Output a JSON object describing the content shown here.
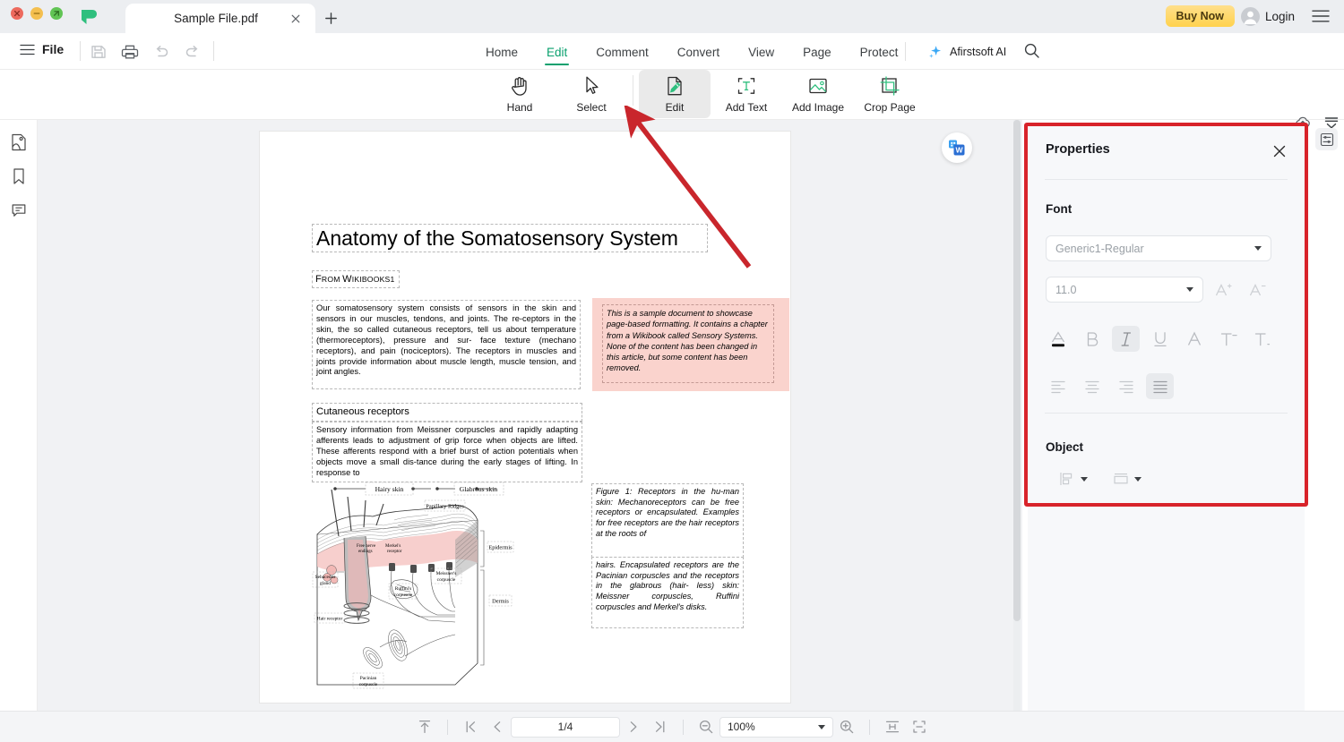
{
  "window": {
    "app_logo": "afirstsoft-logo-icon",
    "traffic_lights": [
      "close",
      "minimize",
      "maximize"
    ],
    "tab": {
      "title": "Sample File.pdf",
      "close_label": "×"
    },
    "new_tab_label": "+",
    "buy_now_label": "Buy Now",
    "login_label": "Login",
    "menu_icon": "hamburger-icon"
  },
  "menubar": {
    "file_label": "File",
    "quick_actions": [
      "save-icon",
      "print-icon",
      "undo-icon",
      "redo-icon"
    ],
    "tabs": [
      {
        "label": "Home",
        "active": false
      },
      {
        "label": "Edit",
        "active": true
      },
      {
        "label": "Comment",
        "active": false
      },
      {
        "label": "Convert",
        "active": false
      },
      {
        "label": "View",
        "active": false
      },
      {
        "label": "Page",
        "active": false
      },
      {
        "label": "Protect",
        "active": false
      }
    ],
    "ai_label": "Afirstsoft AI",
    "search_icon": "search-icon",
    "upload_icon": "cloud-upload-icon",
    "collapse_icon": "collapse-ribbon-icon"
  },
  "ribbon": {
    "tools": [
      {
        "label": "Hand",
        "icon": "hand-icon",
        "active": false
      },
      {
        "label": "Select",
        "icon": "cursor-arrow-icon",
        "active": false
      },
      {
        "label": "Edit",
        "icon": "edit-pencil-document-icon",
        "active": true
      },
      {
        "label": "Add Text",
        "icon": "add-text-icon",
        "active": false
      },
      {
        "label": "Add Image",
        "icon": "add-image-icon",
        "active": false
      },
      {
        "label": "Crop Page",
        "icon": "crop-page-icon",
        "active": false
      }
    ]
  },
  "left_rail": {
    "items": [
      {
        "icon": "thumbnail-page-icon",
        "name": "page-thumbnails"
      },
      {
        "icon": "bookmark-icon",
        "name": "bookmarks"
      },
      {
        "icon": "comment-icon",
        "name": "comments"
      }
    ]
  },
  "viewer": {
    "word_badge": "convert-to-word-icon",
    "document": {
      "title": "Anatomy of the Somatosensory System",
      "source_line": "From Wikibooks1",
      "source_line_parts": {
        "f": "F",
        "rom": "ROM ",
        "w": "W",
        "ikibooks": "IKIBOOKS",
        "num": "1"
      },
      "paragraph_1": "Our somatosensory system consists of sensors in the skin and sensors in our muscles, tendons, and joints. The re-ceptors in the skin, the so called cutaneous receptors, tell us about temperature (thermoreceptors), pressure and sur- face texture (mechano receptors), and pain (nociceptors). The receptors in muscles and joints provide information about muscle length, muscle tension, and joint angles.",
      "pink_note": "This is a sample document to showcase page-based formatting. It contains a chapter from a Wikibook called Sensory Systems. None of the content has been changed in this article, but some content has been removed.",
      "heading_2": "Cutaneous receptors",
      "paragraph_2": "Sensory information from Meissner corpuscles and rapidly adapting afferents leads to adjustment of grip force when objects are lifted. These afferents respond with a brief burst of action potentials when objects move a small dis-tance during the early stages of lifting. In response to",
      "figure_caption_a": "Figure 1: Receptors in the hu-man skin: Mechanoreceptors can be free receptors or encapsulated. Examples for free receptors are the hair receptors at the roots of",
      "figure_caption_b": "hairs. Encapsulated receptors are the Pacinian corpuscles and the receptors in the glabrous (hair- less) skin: Meissner corpuscles, Ruffini corpuscles and Merkel's disks.",
      "figure_labels": {
        "hairy_skin": "Hairy skin",
        "glabrous_skin": "Glabrous skin",
        "papillary_ridges": "Papillary Ridges",
        "epidermis": "Epidermis",
        "dermis": "Dermis",
        "free_nerve": "Free nerve endings",
        "merkel": "Merkel's receptor",
        "meissner": "Meissner's corpuscle",
        "ruffini": "Ruffini's corpuscle",
        "sebaceous": "Sebaceous gland",
        "hair_receptor": "Hair receptor",
        "pacinian": "Pacinian corpuscle"
      }
    }
  },
  "properties_panel": {
    "title": "Properties",
    "close_icon": "close-icon",
    "font_section_label": "Font",
    "font_family": {
      "value": "Generic1-Regular",
      "icon": "chevron-down-icon"
    },
    "font_size": {
      "value": "11.0",
      "icon": "chevron-down-icon"
    },
    "increase_font_icon": "increase-font-size-icon",
    "decrease_font_icon": "decrease-font-size-icon",
    "format_buttons": [
      {
        "name": "font-color",
        "glyph": "A",
        "active": false
      },
      {
        "name": "bold",
        "glyph": "B",
        "active": false
      },
      {
        "name": "italic",
        "glyph": "I",
        "active": true
      },
      {
        "name": "underline",
        "glyph": "U",
        "active": false
      },
      {
        "name": "strikethrough",
        "glyph": "A",
        "active": false
      },
      {
        "name": "superscript",
        "glyph": "T",
        "active": false
      },
      {
        "name": "subscript",
        "glyph": "T",
        "active": false
      }
    ],
    "align_buttons": [
      {
        "name": "align-left",
        "active": false
      },
      {
        "name": "align-center",
        "active": false
      },
      {
        "name": "align-right",
        "active": false
      },
      {
        "name": "align-justify",
        "active": true
      }
    ],
    "object_section_label": "Object",
    "object_buttons": [
      {
        "name": "align-objects",
        "icon": "object-align-icon"
      },
      {
        "name": "arrange-objects",
        "icon": "object-arrange-icon"
      }
    ],
    "highlight_color": "#d8232a"
  },
  "right_rail": {
    "toggle_icon": "properties-toggle-icon"
  },
  "bottom_bar": {
    "fit_top_icon": "scroll-to-top-icon",
    "first_page_icon": "first-page-icon",
    "prev_page_icon": "prev-page-icon",
    "page_value": "1/4",
    "next_page_icon": "next-page-icon",
    "last_page_icon": "last-page-icon",
    "zoom_out_icon": "zoom-out-icon",
    "zoom_value": "100%",
    "zoom_caret_icon": "chevron-down-icon",
    "zoom_in_icon": "zoom-in-icon",
    "fit_width_icon": "fit-width-icon",
    "fit_page_icon": "fit-page-icon"
  },
  "annotation": {
    "arrow_color": "#c9262c",
    "points_to": "Edit tool"
  },
  "colors": {
    "accent_green": "#0aa06e",
    "buy_now_yellow": "#ffd24d",
    "annotation_red": "#d8232a",
    "panel_bg": "#f7f8fa",
    "viewer_bg": "#f1f2f4",
    "pink_note": "#fad3cd"
  }
}
